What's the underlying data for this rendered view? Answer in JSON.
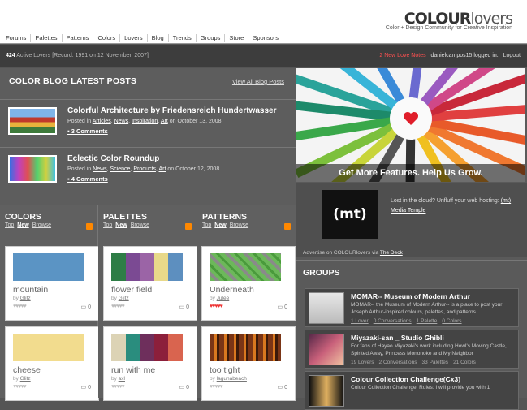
{
  "brand": {
    "logo_bold": "COLOUR",
    "logo_light": "lovers",
    "tagline": "Color + Design Community for Creative Inspiration"
  },
  "nav": [
    "Forums",
    "Palettes",
    "Patterns",
    "Colors",
    "Lovers",
    "Blog",
    "Trends",
    "Groups",
    "Store",
    "Sponsors"
  ],
  "status": {
    "count": "424",
    "left_text": " Active Lovers [Record: 1991 on 12 November, 2007]",
    "notes": "2 New Love Notes",
    "user": "danielcampos15",
    "logged": " logged in.",
    "logout": "Logout"
  },
  "blog": {
    "title": "COLOR BLOG LATEST POSTS",
    "view_all": "View All Blog Posts",
    "posts": [
      {
        "title": "Colorful Architecture by Friedensreich Hundertwasser",
        "posted_in": "Posted in ",
        "tags": [
          "Articles",
          "News",
          "Inspiration",
          "Art"
        ],
        "date": " on October 13, 2008",
        "comments": "3 Comments"
      },
      {
        "title": "Eclectic Color Roundup",
        "posted_in": "Posted in ",
        "tags": [
          "News",
          "Science",
          "Products",
          "Art"
        ],
        "date": " on October 12, 2008",
        "comments": "4 Comments"
      }
    ]
  },
  "columns": [
    {
      "title": "COLORS",
      "links": [
        "Top",
        "New",
        "Browse"
      ],
      "cards": [
        {
          "name": "mountain",
          "by_prefix": "by ",
          "author": "Glitz",
          "hearts": "♥♥♥♥♥",
          "hearts_red": false,
          "comments": "0",
          "swatches": [
            "#5b94c4"
          ]
        },
        {
          "name": "cheese",
          "by_prefix": "by ",
          "author": "Glitz",
          "hearts": "♥♥♥♥♥",
          "hearts_red": false,
          "comments": "0",
          "swatches": [
            "#f2dc8e"
          ]
        }
      ]
    },
    {
      "title": "PALETTES",
      "links": [
        "Top",
        "New",
        "Browse"
      ],
      "cards": [
        {
          "name": "flower field",
          "by_prefix": "by ",
          "author": "Glitz",
          "hearts": "♥♥♥♥♥",
          "hearts_red": false,
          "comments": "0",
          "swatches": [
            "#2e7d46",
            "#7b4a93",
            "#9b64a6",
            "#e8d98a",
            "#5d8fbf"
          ]
        },
        {
          "name": "run with me",
          "by_prefix": "by ",
          "author": "axl",
          "hearts": "♥♥♥♥♥",
          "hearts_red": false,
          "comments": "0",
          "swatches": [
            "#dcd3b5",
            "#2a8d7e",
            "#6e2f5c",
            "#8c1f3b",
            "#d9644f"
          ]
        }
      ]
    },
    {
      "title": "PATTERNS",
      "links": [
        "Top",
        "New",
        "Browse"
      ],
      "cards": [
        {
          "name": "Underneath",
          "by_prefix": "by ",
          "author": "Julee",
          "hearts": "♥♥♥♥♥",
          "hearts_red": true,
          "comments": "0",
          "swatches": [
            "#6cb85a"
          ]
        },
        {
          "name": "too tight",
          "by_prefix": "by ",
          "author": "lagunabeach",
          "hearts": "♥♥♥♥♥",
          "hearts_red": false,
          "comments": "0",
          "swatches": [
            "#7a3516"
          ]
        }
      ]
    }
  ],
  "hero": {
    "caption": "Get More Features. Help Us Grow."
  },
  "ad": {
    "logo": "(mt)",
    "text": "Lost in the cloud? Unfluff your web hosting: ",
    "link": "(mt) Media Temple",
    "via_prefix": "Advertise on COLOURlovers via ",
    "via_link": "The Deck"
  },
  "groups": {
    "title": "GROUPS",
    "items": [
      {
        "name": "MOMAR-- Museum of Modern Arthur",
        "desc": "MOMAR-- the Museum of Modern Arthur-- is a place to post your Joseph Arthur-inspired colours, palettes, and patterns.",
        "stats": [
          "1 Lover",
          "0 Conversations",
          "1 Palette",
          "0 Colors"
        ]
      },
      {
        "name": "Miyazaki-san _ Studio Ghibli",
        "desc": "For fans of Hayao Miyazaki's work including Howl's Moving Castle, Spirited Away, Princess Mononoke and My Neighbor",
        "stats": [
          "19 Lovers",
          "2 Conversations",
          "33 Palettes",
          "21 Colors"
        ]
      },
      {
        "name": "Colour Collection Challenge(Cx3)",
        "desc": "Colour Collection Challenge. Rules: I will provide you with 1",
        "stats": []
      }
    ]
  }
}
